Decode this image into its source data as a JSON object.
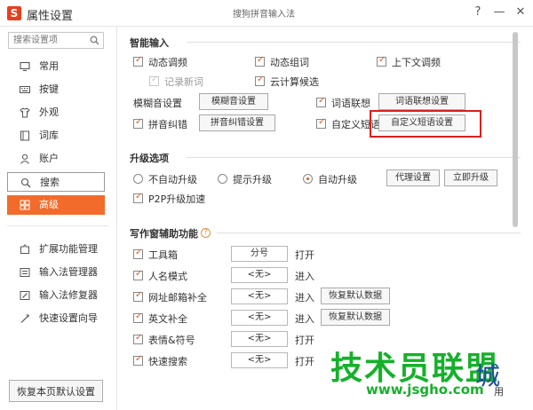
{
  "window": {
    "logo_letter": "S",
    "title": "属性设置",
    "center_title": "搜狗拼音输入法",
    "help_btn": "?",
    "min_btn": "—",
    "close_btn": "✕"
  },
  "sidebar": {
    "search_placeholder": "搜索设置项",
    "items": [
      {
        "label": "常用",
        "icon": "monitor-icon"
      },
      {
        "label": "按键",
        "icon": "keyboard-icon"
      },
      {
        "label": "外观",
        "icon": "shirt-icon"
      },
      {
        "label": "词库",
        "icon": "book-icon"
      },
      {
        "label": "账户",
        "icon": "user-icon"
      },
      {
        "label": "搜索",
        "icon": "search-icon"
      },
      {
        "label": "高级",
        "icon": "advanced-icon"
      },
      {
        "label": "扩展功能管理",
        "icon": "puzzle-icon"
      },
      {
        "label": "输入法管理器",
        "icon": "manager-icon"
      },
      {
        "label": "输入法修复器",
        "icon": "repair-icon"
      },
      {
        "label": "快速设置向导",
        "icon": "wizard-icon"
      }
    ],
    "restore_default": "恢复本页默认设置"
  },
  "smart_input": {
    "title": "智能输入",
    "dynamic_adjust": "动态调频",
    "dynamic_combine": "动态组词",
    "context_adjust": "上下文调频",
    "record_new_words": "记录新词",
    "cloud_candidate": "云计算候选",
    "fuzzy_label": "模糊音设置",
    "fuzzy_btn": "模糊音设置",
    "word_assoc": "词语联想",
    "word_assoc_btn": "词语联想设置",
    "pinyin_correct": "拼音纠错",
    "pinyin_correct_btn": "拼音纠错设置",
    "custom_phrase": "自定义短语",
    "custom_phrase_btn": "自定义短语设置"
  },
  "upgrade": {
    "title": "升级选项",
    "no_auto": "不自动升级",
    "prompt": "提示升级",
    "auto": "自动升级",
    "proxy_btn": "代理设置",
    "upgrade_now_btn": "立即升级",
    "p2p": "P2P升级加速"
  },
  "writing": {
    "title": "写作窗辅助功能",
    "help_icon": "?",
    "rows": [
      {
        "label": "工具箱",
        "key": "分号",
        "action": "打开",
        "restore": ""
      },
      {
        "label": "人名模式",
        "key": "<无>",
        "action": "进入",
        "restore": ""
      },
      {
        "label": "网址邮箱补全",
        "key": "<无>",
        "action": "进入",
        "restore": "恢复默认数据"
      },
      {
        "label": "英文补全",
        "key": "<无>",
        "action": "进入",
        "restore": "恢复默认数据"
      },
      {
        "label": "表情&符号",
        "key": "<无>",
        "action": "打开",
        "restore": ""
      },
      {
        "label": "快速搜索",
        "key": "<无>",
        "action": "打开",
        "restore": ""
      }
    ]
  },
  "watermark": {
    "main": "技术员联盟",
    "url": "www.jsgho.com",
    "city": "城",
    "use": "用"
  },
  "colors": {
    "accent": "#f26b2a",
    "highlight_border": "#d9201d",
    "watermark_green": "#15b12a"
  }
}
